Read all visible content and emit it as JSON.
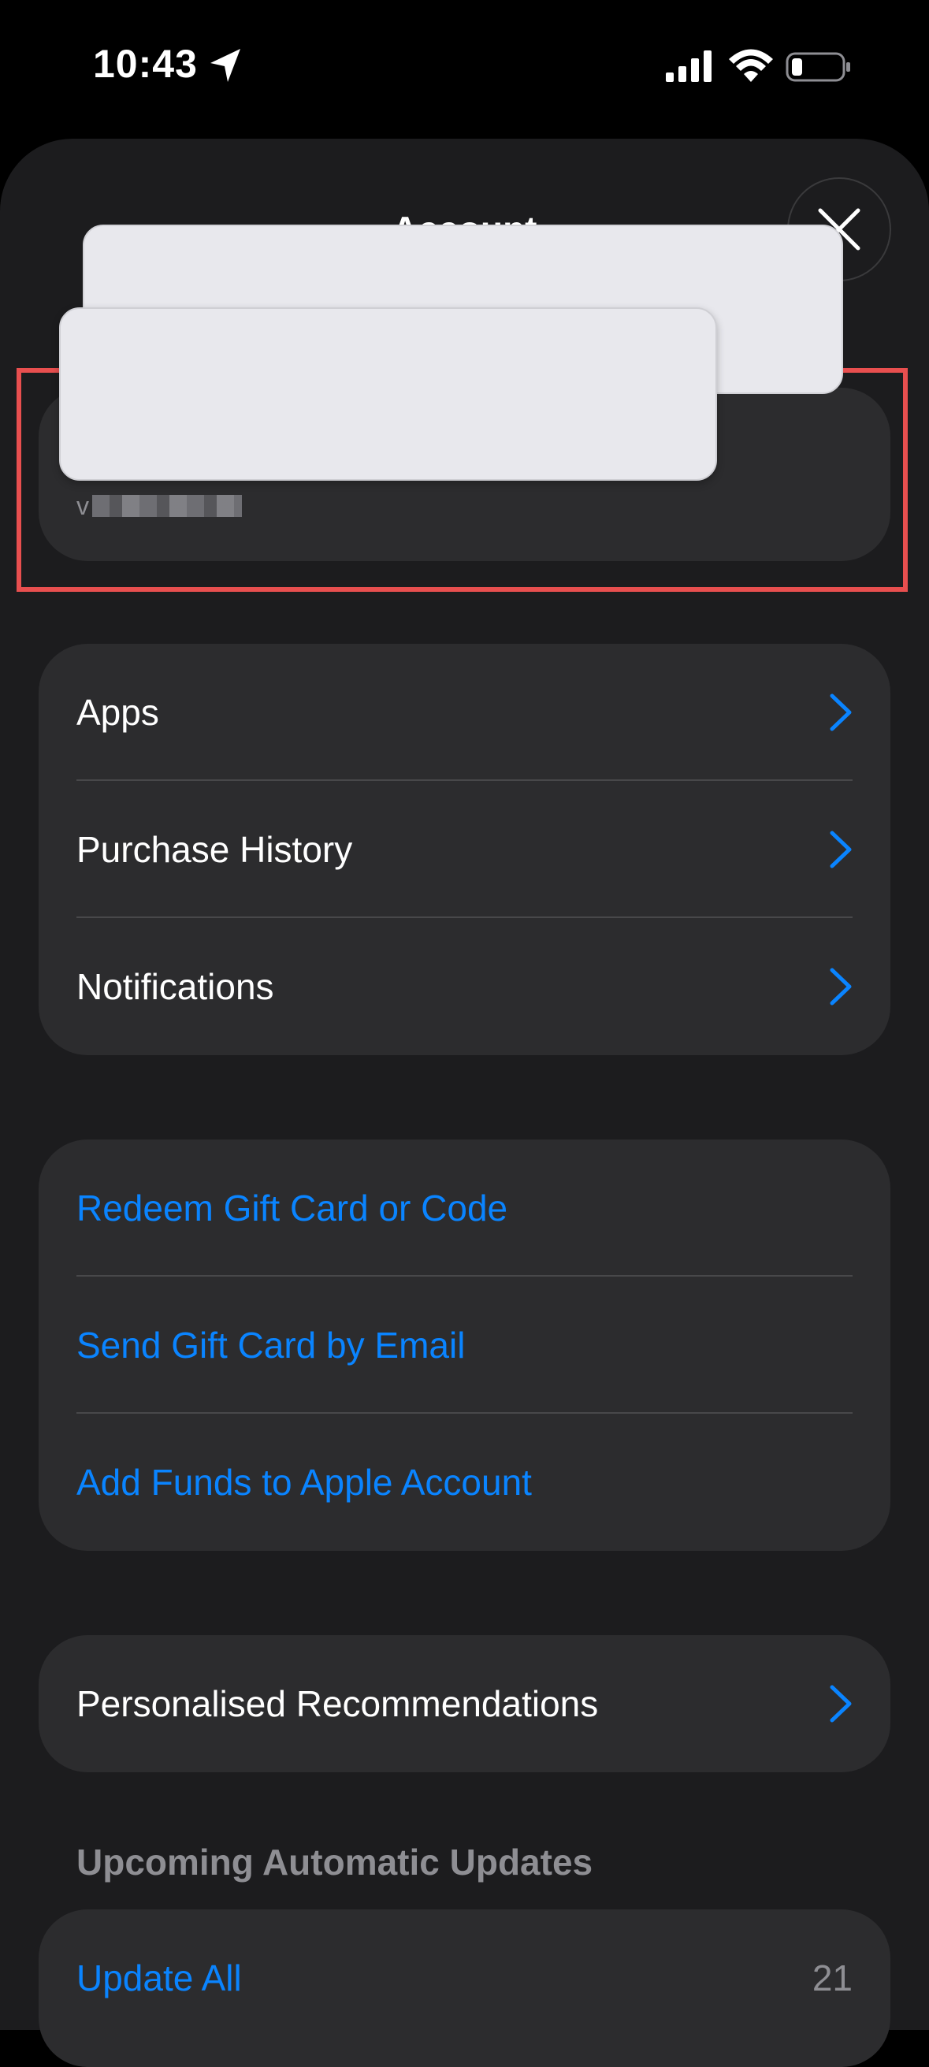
{
  "status_bar": {
    "time": "10:43",
    "icons": [
      "location-arrow-icon",
      "cellular-signal-icon",
      "wifi-icon",
      "battery-icon"
    ]
  },
  "sheet": {
    "title": "Account",
    "close_icon": "close-icon"
  },
  "account": {
    "email_partial": "v"
  },
  "menu_group": {
    "items": [
      {
        "label": "Apps"
      },
      {
        "label": "Purchase History"
      },
      {
        "label": "Notifications"
      }
    ]
  },
  "gift_group": {
    "items": [
      {
        "label": "Redeem Gift Card or Code"
      },
      {
        "label": "Send Gift Card by Email"
      },
      {
        "label": "Add Funds to Apple Account"
      }
    ]
  },
  "recommendations": {
    "label": "Personalised Recommendations"
  },
  "updates": {
    "section_title": "Upcoming Automatic Updates",
    "update_all_label": "Update All",
    "count": "21"
  },
  "colors": {
    "accent": "#0a84ff",
    "highlight": "#e84f4f",
    "group_bg": "#2c2c2e",
    "sheet_bg": "#1c1c1e"
  }
}
